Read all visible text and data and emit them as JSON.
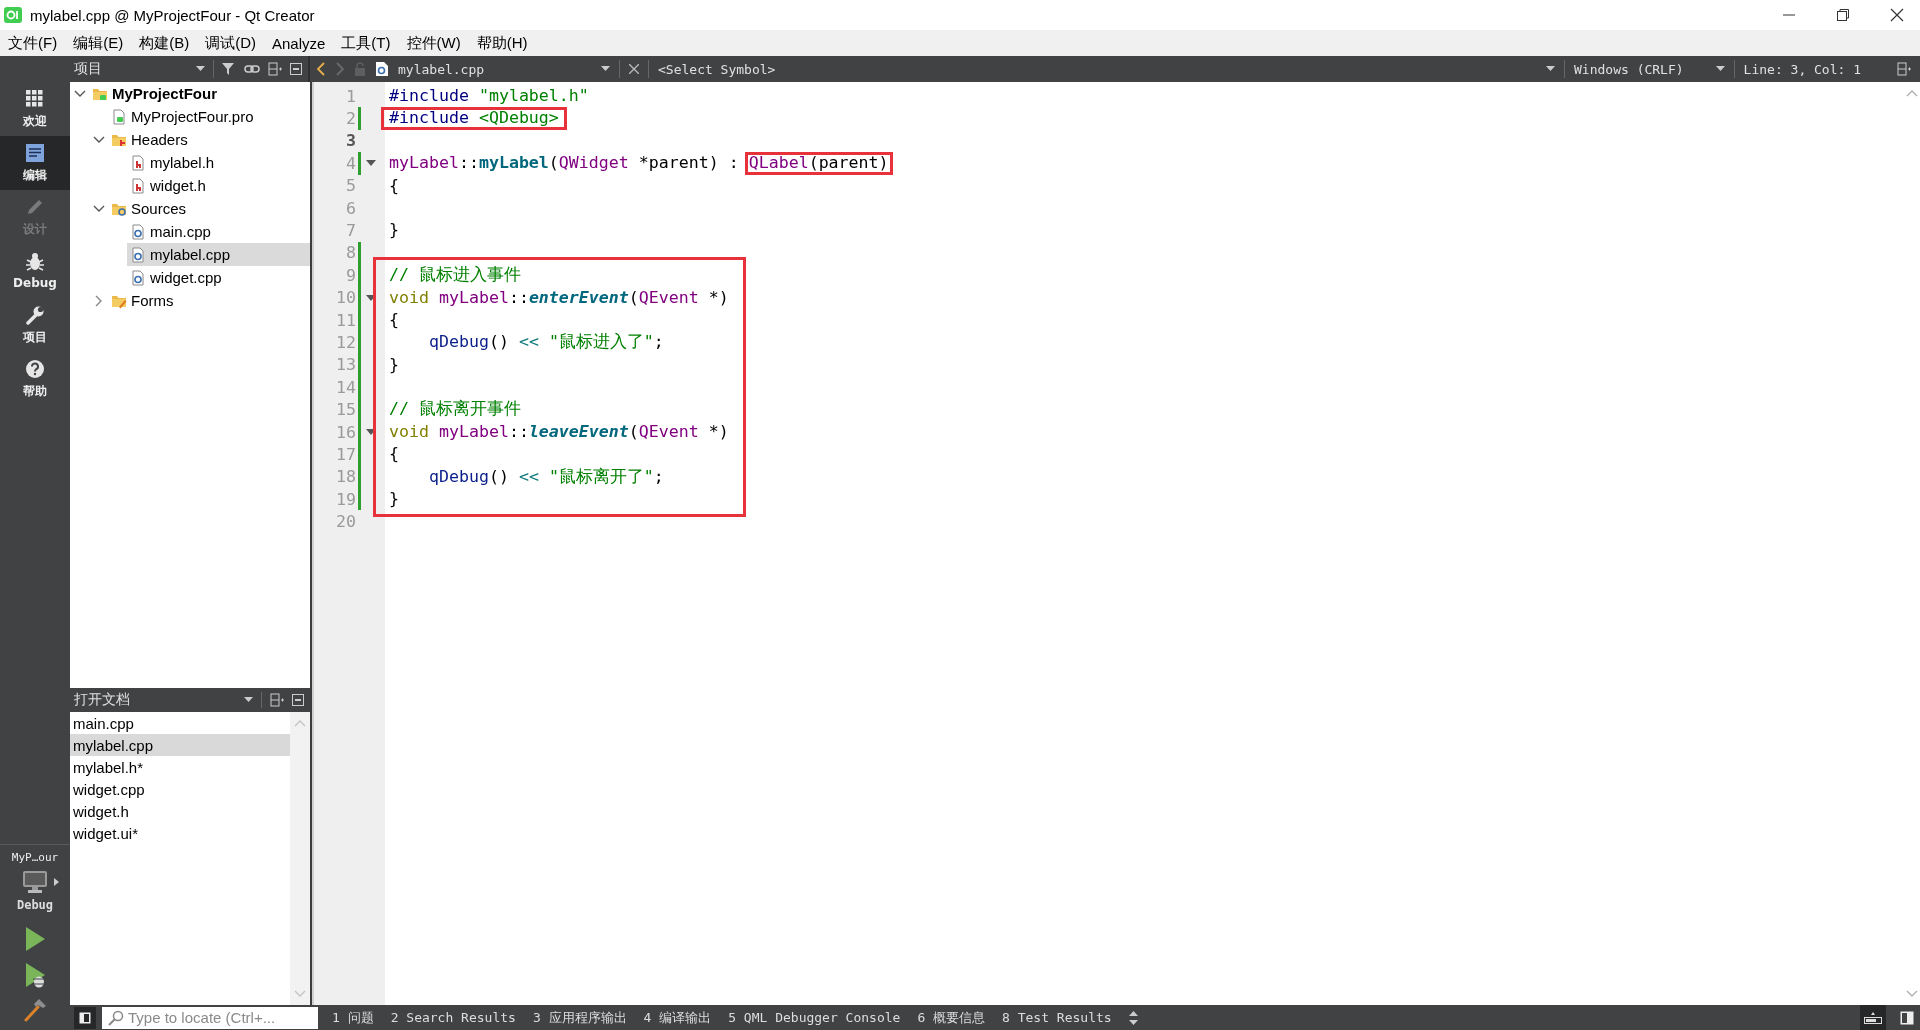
{
  "window": {
    "title": "mylabel.cpp @ MyProjectFour - Qt Creator"
  },
  "menu": [
    "文件(F)",
    "编辑(E)",
    "构建(B)",
    "调试(D)",
    "Analyze",
    "工具(T)",
    "控件(W)",
    "帮助(H)"
  ],
  "modes": [
    {
      "label": "欢迎",
      "kind": "welcome",
      "selected": false,
      "disabled": false
    },
    {
      "label": "编辑",
      "kind": "edit",
      "selected": true,
      "disabled": false
    },
    {
      "label": "设计",
      "kind": "design",
      "selected": false,
      "disabled": true
    },
    {
      "label": "Debug",
      "kind": "debug",
      "selected": false,
      "disabled": false
    },
    {
      "label": "项目",
      "kind": "projects",
      "selected": false,
      "disabled": false
    },
    {
      "label": "帮助",
      "kind": "help",
      "selected": false,
      "disabled": false
    }
  ],
  "kit": {
    "project": "MyP…our",
    "config": "Debug"
  },
  "project_panel": {
    "title": "项目"
  },
  "tree": [
    {
      "label": "MyProjectFour",
      "kind": "project",
      "expanded": true,
      "selected": false,
      "children": [
        {
          "label": "MyProjectFour.pro",
          "kind": "pro",
          "selected": false
        },
        {
          "label": "Headers",
          "kind": "headers",
          "expanded": true,
          "selected": false,
          "children": [
            {
              "label": "mylabel.h",
              "kind": "header",
              "selected": false
            },
            {
              "label": "widget.h",
              "kind": "header",
              "selected": false
            }
          ]
        },
        {
          "label": "Sources",
          "kind": "sources",
          "expanded": true,
          "selected": false,
          "children": [
            {
              "label": "main.cpp",
              "kind": "source",
              "selected": false
            },
            {
              "label": "mylabel.cpp",
              "kind": "source",
              "selected": true
            },
            {
              "label": "widget.cpp",
              "kind": "source",
              "selected": false
            }
          ]
        },
        {
          "label": "Forms",
          "kind": "forms",
          "expanded": false,
          "selected": false
        }
      ]
    }
  ],
  "open_docs": {
    "title": "打开文档",
    "items": [
      {
        "label": "main.cpp",
        "selected": false
      },
      {
        "label": "mylabel.cpp",
        "selected": true
      },
      {
        "label": "mylabel.h*",
        "selected": false
      },
      {
        "label": "widget.cpp",
        "selected": false
      },
      {
        "label": "widget.h",
        "selected": false
      },
      {
        "label": "widget.ui*",
        "selected": false
      }
    ]
  },
  "editor_toolbar": {
    "file": "mylabel.cpp",
    "symbol": "<Select Symbol>",
    "line_ending": "Windows (CRLF)",
    "position": "Line: 3, Col: 1"
  },
  "code": [
    {
      "number": "1",
      "current": false,
      "changed": false,
      "fold": false,
      "marked": false,
      "tokens": [
        {
          "kind": "preprocessor",
          "text": "#include "
        },
        {
          "kind": "string",
          "text": "\"mylabel.h\""
        }
      ]
    },
    {
      "number": "2",
      "current": false,
      "changed": true,
      "fold": false,
      "marked": true,
      "tokens": [
        {
          "kind": "preprocessor",
          "text": "#include "
        },
        {
          "kind": "string",
          "text": "<QDebug>"
        }
      ]
    },
    {
      "number": "3",
      "current": true,
      "changed": false,
      "fold": false,
      "marked": false
    },
    {
      "number": "4",
      "current": false,
      "changed": true,
      "fold": true,
      "marked": false,
      "tokens": [
        {
          "kind": "type",
          "text": "myLabel"
        },
        {
          "kind": "plain",
          "text": "::"
        },
        {
          "kind": "declaration",
          "text": "myLabel"
        },
        {
          "kind": "plain",
          "text": "("
        },
        {
          "kind": "type",
          "text": "QWidget"
        },
        {
          "kind": "plain",
          "text": " *parent) : "
        },
        {
          "kind": "type",
          "text": "QLabel",
          "marked": true
        },
        {
          "kind": "plain",
          "text": "(parent)",
          "marked": true
        }
      ]
    },
    {
      "number": "5",
      "current": false,
      "changed": false,
      "fold": false,
      "marked": false,
      "tokens": [
        {
          "kind": "plain",
          "text": "{"
        }
      ]
    },
    {
      "number": "6",
      "current": false,
      "changed": false,
      "fold": false,
      "marked": false
    },
    {
      "number": "7",
      "current": false,
      "changed": false,
      "fold": false,
      "marked": false,
      "tokens": [
        {
          "kind": "plain",
          "text": "}"
        }
      ]
    },
    {
      "number": "8",
      "current": false,
      "changed": true,
      "fold": false,
      "marked": false
    },
    {
      "number": "9",
      "current": false,
      "changed": true,
      "fold": false,
      "marked": true,
      "tokens": [
        {
          "kind": "comment",
          "text": "// 鼠标进入事件"
        }
      ]
    },
    {
      "number": "10",
      "current": false,
      "changed": true,
      "fold": true,
      "marked": true,
      "tokens": [
        {
          "kind": "keyword",
          "text": "void "
        },
        {
          "kind": "type",
          "text": "myLabel"
        },
        {
          "kind": "plain",
          "text": "::"
        },
        {
          "kind": "virtual",
          "text": "enterEvent"
        },
        {
          "kind": "plain",
          "text": "("
        },
        {
          "kind": "type",
          "text": "QEvent"
        },
        {
          "kind": "plain",
          "text": " *)"
        }
      ]
    },
    {
      "number": "11",
      "current": false,
      "changed": true,
      "fold": false,
      "marked": true,
      "tokens": [
        {
          "kind": "plain",
          "text": "{"
        }
      ]
    },
    {
      "number": "12",
      "current": false,
      "changed": true,
      "fold": false,
      "marked": true,
      "tokens": [
        {
          "kind": "call",
          "text": "    qDebug"
        },
        {
          "kind": "plain",
          "text": "() "
        },
        {
          "kind": "operator",
          "text": "<< "
        },
        {
          "kind": "string",
          "text": "\"鼠标进入了\""
        },
        {
          "kind": "plain",
          "text": ";"
        }
      ]
    },
    {
      "number": "13",
      "current": false,
      "changed": true,
      "fold": false,
      "marked": true,
      "tokens": [
        {
          "kind": "plain",
          "text": "}"
        }
      ]
    },
    {
      "number": "14",
      "current": false,
      "changed": true,
      "fold": false,
      "marked": true
    },
    {
      "number": "15",
      "current": false,
      "changed": true,
      "fold": false,
      "marked": true,
      "tokens": [
        {
          "kind": "comment",
          "text": "// 鼠标离开事件"
        }
      ]
    },
    {
      "number": "16",
      "current": false,
      "changed": true,
      "fold": true,
      "marked": true,
      "tokens": [
        {
          "kind": "keyword",
          "text": "void "
        },
        {
          "kind": "type",
          "text": "myLabel"
        },
        {
          "kind": "plain",
          "text": "::"
        },
        {
          "kind": "virtual",
          "text": "leaveEvent"
        },
        {
          "kind": "plain",
          "text": "("
        },
        {
          "kind": "type",
          "text": "QEvent"
        },
        {
          "kind": "plain",
          "text": " *)"
        }
      ]
    },
    {
      "number": "17",
      "current": false,
      "changed": true,
      "fold": false,
      "marked": true,
      "tokens": [
        {
          "kind": "plain",
          "text": "{"
        }
      ]
    },
    {
      "number": "18",
      "current": false,
      "changed": true,
      "fold": false,
      "marked": true,
      "tokens": [
        {
          "kind": "call",
          "text": "    qDebug"
        },
        {
          "kind": "plain",
          "text": "() "
        },
        {
          "kind": "operator",
          "text": "<< "
        },
        {
          "kind": "string",
          "text": "\"鼠标离开了\""
        },
        {
          "kind": "plain",
          "text": ";"
        }
      ]
    },
    {
      "number": "19",
      "current": false,
      "changed": true,
      "fold": false,
      "marked": true,
      "tokens": [
        {
          "kind": "plain",
          "text": "}"
        }
      ]
    },
    {
      "number": "20",
      "current": false,
      "changed": false,
      "fold": false,
      "marked": false
    }
  ],
  "locator": {
    "placeholder": "Type to locate (Ctrl+..."
  },
  "output_tabs": [
    "1 问题",
    "2 Search Results",
    "3 应用程序输出",
    "4 编译输出",
    "5 QML Debugger Console",
    "6 概要信息",
    "8 Test Results"
  ]
}
